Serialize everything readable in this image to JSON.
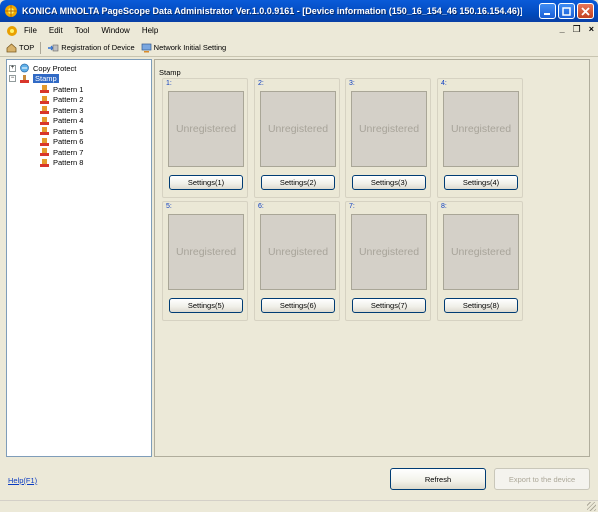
{
  "window": {
    "title": "KONICA MINOLTA PageScope Data Administrator Ver.1.0.0.9161 - [Device information (150_16_154_46 150.16.154.46)]"
  },
  "menu": {
    "items": [
      {
        "label": "File",
        "mnemonic": "F"
      },
      {
        "label": "Edit",
        "mnemonic": "E"
      },
      {
        "label": "Tool",
        "mnemonic": "T"
      },
      {
        "label": "Window",
        "mnemonic": "W"
      },
      {
        "label": "Help",
        "mnemonic": "e"
      }
    ],
    "minimize": "_",
    "restore": "ё",
    "close": "×"
  },
  "toolbar": {
    "top": "TOP",
    "registration": "Registration of Device",
    "network": "Network Initial Setting"
  },
  "tree": {
    "copy_protect": "Copy Protect",
    "stamp": "Stamp",
    "patterns": [
      "Pattern 1",
      "Pattern 2",
      "Pattern 3",
      "Pattern 4",
      "Pattern 5",
      "Pattern 6",
      "Pattern 7",
      "Pattern 8"
    ]
  },
  "content": {
    "label": "Stamp",
    "slots": [
      {
        "num": "1:",
        "status": "Unregistered",
        "button": "Settings(1)"
      },
      {
        "num": "2:",
        "status": "Unregistered",
        "button": "Settings(2)"
      },
      {
        "num": "3:",
        "status": "Unregistered",
        "button": "Settings(3)"
      },
      {
        "num": "4:",
        "status": "Unregistered",
        "button": "Settings(4)"
      },
      {
        "num": "5:",
        "status": "Unregistered",
        "button": "Settings(5)"
      },
      {
        "num": "6:",
        "status": "Unregistered",
        "button": "Settings(6)"
      },
      {
        "num": "7:",
        "status": "Unregistered",
        "button": "Settings(7)"
      },
      {
        "num": "8:",
        "status": "Unregistered",
        "button": "Settings(8)"
      }
    ]
  },
  "bottom": {
    "help": "Help(F1)",
    "refresh": "Refresh",
    "export": "Export to the device"
  }
}
